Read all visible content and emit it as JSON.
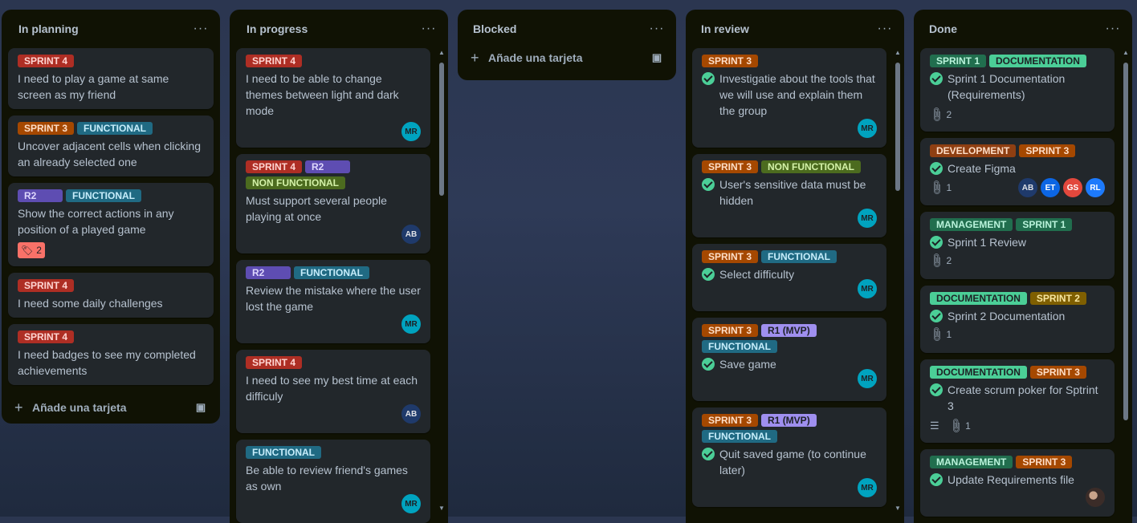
{
  "lists": {
    "planning": {
      "title": "In planning",
      "add_label": "Añade una tarjeta",
      "cards": [
        {
          "labels": [
            "SPRINT 4"
          ],
          "title": "I need to play a game at same screen as my friend"
        },
        {
          "labels": [
            "SPRINT 3",
            "FUNCTIONAL"
          ],
          "title": "Uncover adjacent cells when clicking an already selected one"
        },
        {
          "labels": [
            "R2",
            "FUNCTIONAL"
          ],
          "title": "Show the correct actions in any position of a played game",
          "votes": "2"
        },
        {
          "labels": [
            "SPRINT 4"
          ],
          "title": "I need some daily challenges"
        },
        {
          "labels": [
            "SPRINT 4"
          ],
          "title": "I need badges to see my completed achievements"
        }
      ]
    },
    "progress": {
      "title": "In progress",
      "cards": [
        {
          "labels": [
            "SPRINT 4"
          ],
          "title": "I need to be able to change themes between light and dark mode",
          "avatar": "MR"
        },
        {
          "labels": [
            "SPRINT 4",
            "R2",
            "NON FUNCTIONAL"
          ],
          "title": "Must support several people playing at once",
          "avatar": "AB"
        },
        {
          "labels": [
            "R2",
            "FUNCTIONAL"
          ],
          "title": "Review the mistake where the user lost the game",
          "avatar": "MR"
        },
        {
          "labels": [
            "SPRINT 4"
          ],
          "title": "I need to see my best time at each difficuly",
          "avatar": "AB"
        },
        {
          "labels": [
            "FUNCTIONAL"
          ],
          "title": "Be able to review friend's games as own",
          "avatar": "MR"
        }
      ]
    },
    "blocked": {
      "title": "Blocked",
      "add_label": "Añade una tarjeta"
    },
    "review": {
      "title": "In review",
      "cards": [
        {
          "labels": [
            "SPRINT 3"
          ],
          "title": "Investigatie about the tools that we will use and explain them the group",
          "avatar": "MR"
        },
        {
          "labels": [
            "SPRINT 3",
            "NON FUNCTIONAL"
          ],
          "title": "User's sensitive data must be hidden",
          "avatar": "MR"
        },
        {
          "labels": [
            "SPRINT 3",
            "FUNCTIONAL"
          ],
          "title": "Select difficulty",
          "avatar": "MR"
        },
        {
          "labels": [
            "SPRINT 3",
            "R1 (MVP)",
            "FUNCTIONAL"
          ],
          "title": "Save game",
          "avatar": "MR"
        },
        {
          "labels": [
            "SPRINT 3",
            "R1 (MVP)",
            "FUNCTIONAL"
          ],
          "title": "Quit saved game (to continue later)",
          "avatar": "MR"
        }
      ]
    },
    "done": {
      "title": "Done",
      "cards": [
        {
          "labels": [
            "SPRINT 1",
            "DOCUMENTATION"
          ],
          "title": "Sprint 1 Documentation (Requirements)",
          "attachments": "2"
        },
        {
          "labels": [
            "DEVELOPMENT",
            "SPRINT 3"
          ],
          "title": "Create Figma",
          "attachments": "1",
          "avatars": [
            "AB",
            "ET",
            "GS",
            "RL"
          ]
        },
        {
          "labels": [
            "MANAGEMENT",
            "SPRINT 1"
          ],
          "title": "Sprint 1 Review",
          "attachments": "2"
        },
        {
          "labels": [
            "DOCUMENTATION",
            "SPRINT 2"
          ],
          "title": "Sprint 2 Documentation",
          "attachments": "1"
        },
        {
          "labels": [
            "DOCUMENTATION",
            "SPRINT 3"
          ],
          "title": "Create scrum poker for Sptrint 3",
          "attachments": "1"
        },
        {
          "labels": [
            "MANAGEMENT",
            "SPRINT 3"
          ],
          "title": "Update Requirements file"
        }
      ]
    }
  },
  "icons": {
    "menu": "more-dots-icon",
    "add": "plus-icon",
    "template": "card-template-icon",
    "check": "completed-check-icon",
    "attachment": "paperclip-icon",
    "description": "description-lines-icon",
    "vote": "thumbs-up-icon"
  },
  "colors": {
    "list_bg": "#101204",
    "card_bg": "#22272b",
    "check_green": "#4bce97",
    "avatar_mr": "#00a3bf"
  }
}
